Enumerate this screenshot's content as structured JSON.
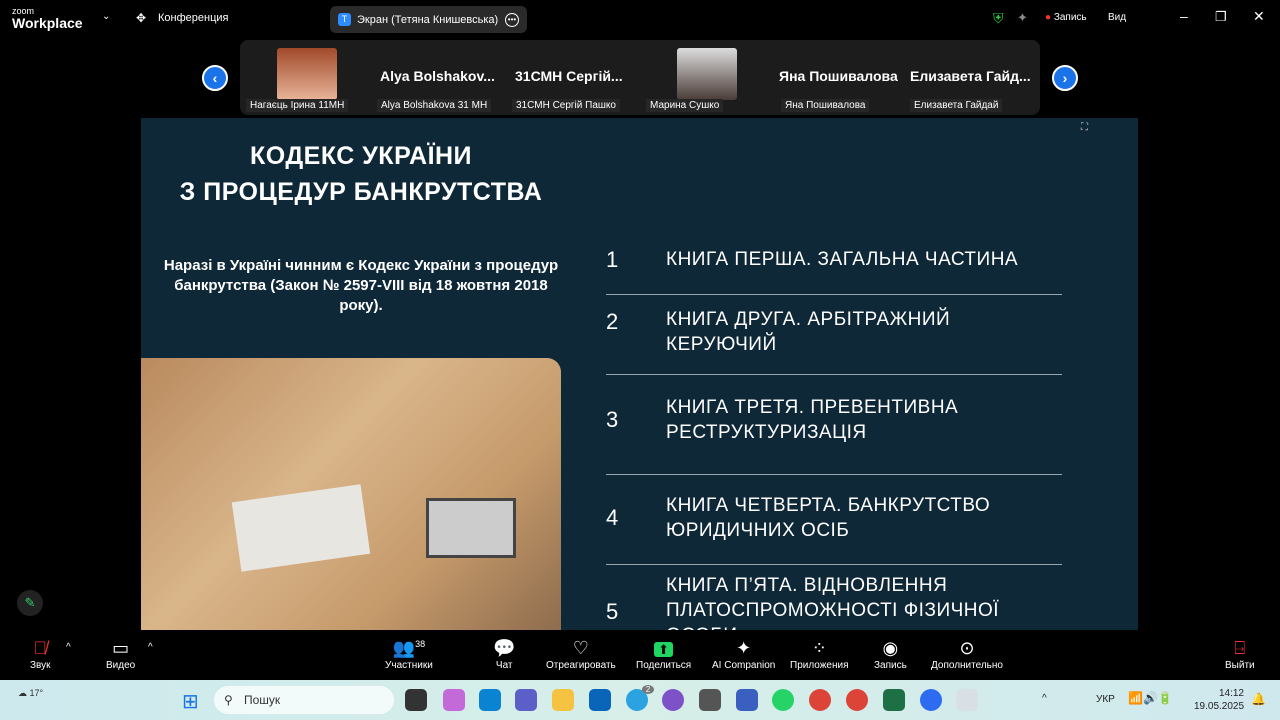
{
  "app": {
    "logo_small": "zoom",
    "logo_big": "Workplace",
    "meeting_menu": "Конференция",
    "share_tab": "Экран (Тетяна Книшевська)",
    "share_tab_initial": "T",
    "record_label": "Запись",
    "view_label": "Вид"
  },
  "participants": [
    {
      "name": "Нагаєць Ірина 11МН",
      "big": ""
    },
    {
      "name": "Alya Bolshakova 31 MH",
      "big": "Alya  Bolshakov..."
    },
    {
      "name": "31СМН Сергій Пашко",
      "big": "31СМН  Сергій..."
    },
    {
      "name": "Марина Сушко",
      "big": ""
    },
    {
      "name": "Яна Пошивалова",
      "big": "Яна Пошивалова"
    },
    {
      "name": "Елизавета Гайдай",
      "big": "Елизавета  Гайд..."
    }
  ],
  "slide": {
    "title_line1": "КОДЕКС УКРАЇНИ",
    "title_line2": "З ПРОЦЕДУР БАНКРУТСТВА",
    "intro": "Наразі в Україні чинним є Кодекс України з процедур банкрутства (Закон № 2597-VIII від 18 жовтня 2018 року).",
    "items": [
      {
        "num": "1",
        "text": "КНИГА ПЕРША. ЗАГАЛЬНА ЧАСТИНА"
      },
      {
        "num": "2",
        "text": "КНИГА ДРУГА. АРБІТРАЖНИЙ КЕРУЮЧИЙ"
      },
      {
        "num": "3",
        "text": "КНИГА ТРЕТЯ. ПРЕВЕНТИВНА РЕСТРУКТУРИЗАЦІЯ"
      },
      {
        "num": "4",
        "text": "КНИГА ЧЕТВЕРТА. БАНКРУТСТВО ЮРИДИЧНИХ ОСІБ"
      },
      {
        "num": "5",
        "text": "КНИГА П’ЯТА. ВІДНОВЛЕННЯ ПЛАТОСПРОМОЖНОСТІ ФІЗИЧНОЇ ОСОБИ"
      }
    ]
  },
  "toolbar": {
    "audio": "Звук",
    "video": "Видео",
    "participants": "Участники",
    "participants_count": "38",
    "chat": "Чат",
    "react": "Отреагировать",
    "share": "Поделиться",
    "ai": "AI Companion",
    "apps": "Приложения",
    "record": "Запись",
    "more": "Дополнительно",
    "leave": "Выйти"
  },
  "taskbar": {
    "weather": "17°",
    "search": "Пошук",
    "lang": "УКР",
    "time": "14:12",
    "date": "19.05.2025",
    "telegram_badge": "2"
  }
}
